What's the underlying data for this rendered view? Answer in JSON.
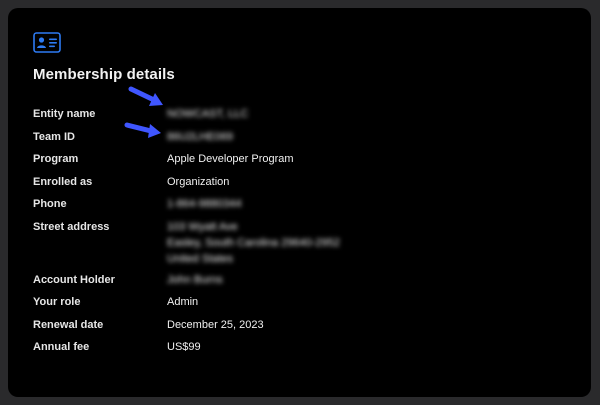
{
  "card": {
    "title": "Membership details",
    "icon": "member-card-icon",
    "accent_color": "#2d7bf4"
  },
  "rows": [
    {
      "label": "Entity name",
      "value": [
        "NOWCAST, LLC"
      ],
      "blurred": true
    },
    {
      "label": "Team ID",
      "value": [
        "86U2LHE069"
      ],
      "blurred": true
    },
    {
      "label": "Program",
      "value": [
        "Apple Developer Program"
      ],
      "blurred": false
    },
    {
      "label": "Enrolled as",
      "value": [
        "Organization"
      ],
      "blurred": false
    },
    {
      "label": "Phone",
      "value": [
        "1-864-9880344"
      ],
      "blurred": true
    },
    {
      "label": "Street address",
      "value": [
        "103 Wyatt Ave",
        "Easley, South Carolina 29640-2952",
        "United States"
      ],
      "blurred": true
    },
    {
      "label": "Account Holder",
      "value": [
        "John Burns"
      ],
      "blurred": true,
      "link": true
    },
    {
      "label": "Your role",
      "value": [
        "Admin"
      ],
      "blurred": false
    },
    {
      "label": "Renewal date",
      "value": [
        "December 25, 2023"
      ],
      "blurred": false
    },
    {
      "label": "Annual fee",
      "value": [
        "US$99"
      ],
      "blurred": false
    }
  ],
  "annotations": {
    "arrow_color": "#3f56ff",
    "arrow_icon": "annotation-arrow-icon"
  }
}
